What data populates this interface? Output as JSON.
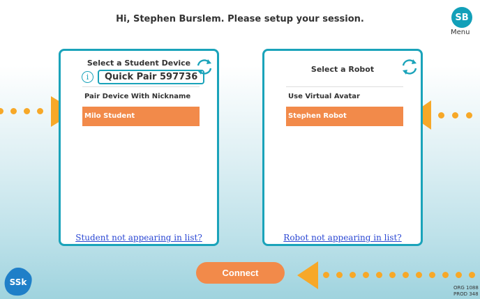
{
  "header": {
    "greeting": "Hi, Stephen Burslem. Please setup your session.",
    "avatar_initials": "SB",
    "menu_label": "Menu"
  },
  "student_panel": {
    "title": "Select a Student Device",
    "quick_pair": "Quick Pair 597736",
    "items": [
      {
        "label": "Pair Device With Nickname",
        "selected": false
      },
      {
        "label": "Milo Student",
        "selected": true
      }
    ],
    "not_in_list": "Student not appearing in list?"
  },
  "robot_panel": {
    "title": "Select a Robot",
    "items": [
      {
        "label": "Use Virtual Avatar",
        "selected": false
      },
      {
        "label": "Stephen Robot",
        "selected": true
      }
    ],
    "not_in_list": "Robot not appearing in list?"
  },
  "connect_label": "Connect",
  "logo_text": "SSk",
  "footer": {
    "org": "ORG 1088",
    "prod": "PROD 348"
  },
  "colors": {
    "accent_teal": "#1aa3ba",
    "selected_orange": "#f28a4a",
    "arrow_yellow": "#f7a828",
    "link_blue": "#2a47d3"
  }
}
